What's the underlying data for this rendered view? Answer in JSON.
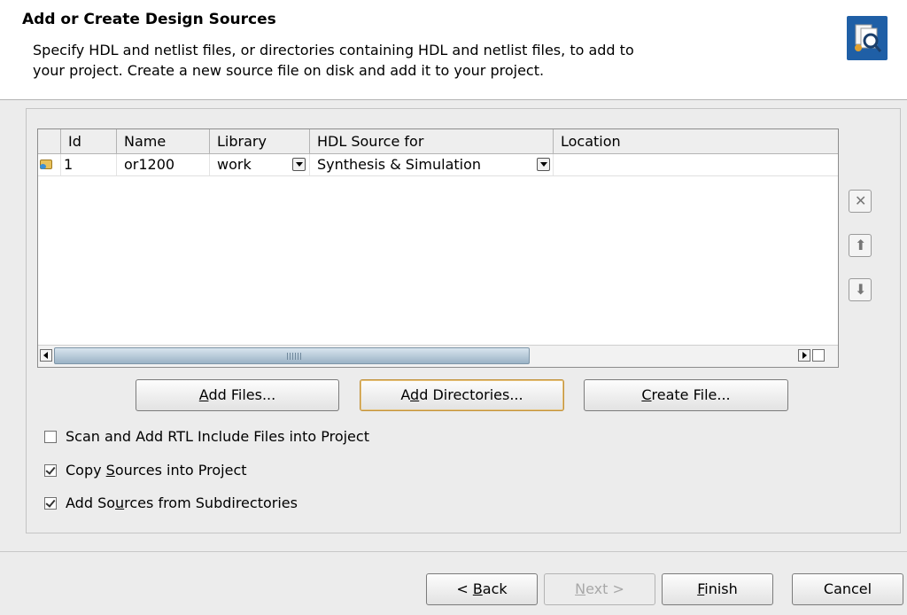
{
  "header": {
    "title": "Add or Create Design Sources",
    "description_line1": "Specify HDL and netlist files, or directories containing HDL and netlist files, to add to",
    "description_line2": "your project. Create a new source file on disk and add it to your project."
  },
  "table": {
    "columns": [
      "Id",
      "Name",
      "Library",
      "HDL Source for",
      "Location"
    ],
    "rows": [
      {
        "id": "1",
        "name": "or1200",
        "library": "work",
        "hdl_source_for": "Synthesis & Simulation",
        "location": ""
      }
    ]
  },
  "side_buttons": {
    "remove": "✕",
    "up": "⬆",
    "down": "⬇"
  },
  "actions": {
    "add_files_prefix": "",
    "add_files_mn": "A",
    "add_files_rest": "dd Files...",
    "add_dirs_prefix": "A",
    "add_dirs_mn": "d",
    "add_dirs_rest": "d Directories...",
    "create_prefix": "",
    "create_mn": "C",
    "create_rest": "reate File..."
  },
  "options": {
    "scan_label": "Scan and Add RTL Include Files into Project",
    "scan_checked": false,
    "copy_prefix": "Copy ",
    "copy_mn": "S",
    "copy_rest": "ources into Project",
    "copy_checked": true,
    "subdirs_prefix": "Add So",
    "subdirs_mn": "u",
    "subdirs_rest": "rces from Subdirectories",
    "subdirs_checked": true
  },
  "footer": {
    "back_prefix": "< ",
    "back_mn": "B",
    "back_rest": "ack",
    "next_label": "Next >",
    "next_mn": "N",
    "next_rest": "ext >",
    "finish_mn": "F",
    "finish_rest": "inish",
    "cancel_label": "Cancel"
  }
}
